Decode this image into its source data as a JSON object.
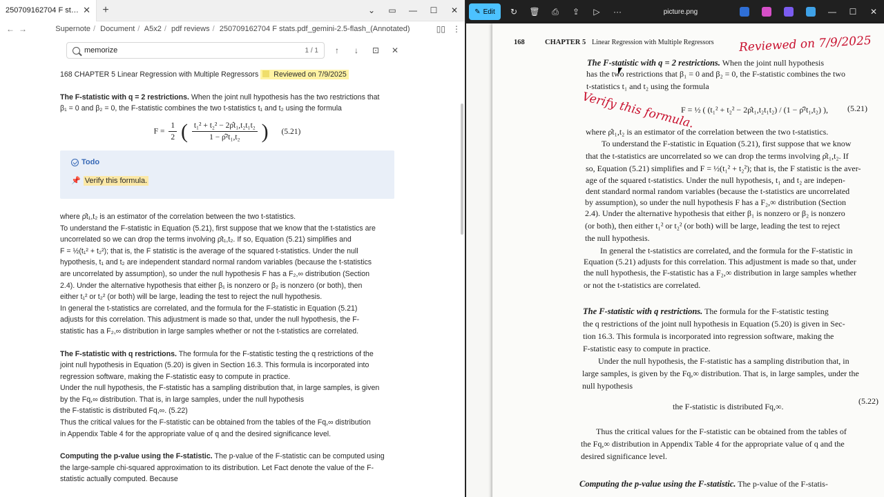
{
  "left_window": {
    "tab_title": "250709162704 F stats.pdf_...",
    "breadcrumbs": [
      "Supernote",
      "Document",
      "A5x2",
      "pdf reviews",
      "250709162704 F stats.pdf_gemini-2.5-flash_(Annotated)"
    ],
    "search": {
      "query": "memorize",
      "count": "1 / 1"
    },
    "doc": {
      "heading": "168 CHAPTER 5 Linear Regression with Multiple Regressors",
      "highlight": "Reviewed on 7/9/2025",
      "p1": [
        "The F-statistic with q = 2 restrictions. When the joint null hypothesis has the two restrictions that",
        "β₁ = 0 and β₂ = 0, the F-statistic combines the two t-statistics t₁ and t₂ using the formula"
      ],
      "formula": {
        "lhs": "F =",
        "half": "1/2",
        "num": "t₁² + t₂² − 2ρ̂t₁,t₂t₁t₂",
        "den": "1 − ρ̂²t₁,t₂",
        "eqno": "(5.21)"
      },
      "todo": {
        "title": "Todo",
        "item": "Verify this formula."
      },
      "p2": [
        "where ρ̂t₁,t₂ is an estimator of the correlation between the two t-statistics.",
        "To understand the F-statistic in Equation (5.21), first suppose that we know that the t-statistics are",
        "uncorrelated so we can drop the terms involving ρ̂t₁,t₂. If so, Equation (5.21) simplifies and",
        "F = ½(t₁² + t₂²); that is, the F statistic is the average of the squared t-statistics. Under the null",
        "hypothesis, t₁ and t₂ are independent standard normal random variables (because the t-statistics",
        "are uncorrelated by assumption), so under the null hypothesis F has a F₂,∞ distribution (Section",
        "2.4). Under the alternative hypothesis that either β₁ is nonzero or β₂ is nonzero (or both), then",
        "either t₁² or t₂² (or both) will be large, leading the test to reject the null hypothesis.",
        "In general the t-statistics are correlated, and the formula for the F-statistic in Equation (5.21)",
        "adjusts for this correlation. This adjustment is made so that, under the null hypothesis, the F-",
        "statistic has a F₂,∞ distribution in large samples whether or not the t-statistics are correlated."
      ],
      "p3": [
        "The F-statistic with q restrictions. The formula for the F-statistic testing the q restrictions of the",
        "joint null hypothesis in Equation (5.20) is given in Section 16.3. This formula is incorporated into",
        "regression software, making the F-statistic easy to compute in practice.",
        "Under the null hypothesis, the F-statistic has a sampling distribution that, in large samples, is given",
        "by the Fq,∞ distribution. That is, in large samples, under the null hypothesis",
        "the F-statistic is distributed Fq,∞. (5.22)",
        "Thus the critical values for the F-statistic can be obtained from the tables of the Fq,∞ distribution",
        "in Appendix Table 4 for the appropriate value of q and the desired significance level."
      ],
      "p4": [
        "Computing the p-value using the F-statistic. The p-value of the F-statistic can be computed using",
        "the large-sample chi-squared approximation to its distribution. Let Fact denote the value of the F-",
        "statistic actually computed. Because"
      ]
    }
  },
  "right_window": {
    "title": "picture.png",
    "edit_label": "Edit",
    "scan": {
      "page_no": "168",
      "chapter": "CHAPTER 5",
      "running_title": "Linear Regression with Multiple Regressors",
      "lines": [
        "The F-statistic with q = 2 restrictions.  When the joint null hypothesis",
        "has the two restrictions that β₁ = 0 and β₂ = 0, the F-statistic combines the two",
        "t-statistics t₁ and t₂ using the formula",
        "F = ½ ( (t₁² + t₂² − 2ρ̂t₁,t₂t₁t₂) / (1 − ρ̂²t₁,t₂) ),",
        "(5.21)",
        "where ρ̂t₁,t₂ is an estimator of the correlation between the two t-statistics.",
        "To understand the F-statistic in Equation (5.21), first suppose that we know",
        "that the t-statistics are uncorrelated so we can drop the terms involving ρ̂t₁,t₂. If",
        "so, Equation (5.21) simplifies and F = ½(t₁² + t₂²); that is, the F statistic is the aver-",
        "age of the squared t-statistics. Under the null hypothesis, t₁ and t₂ are indepen-",
        "dent standard normal random variables (because the t-statistics are uncorrelated",
        "by assumption), so under the null hypothesis F has a F₂,∞ distribution (Section",
        "2.4). Under the alternative hypothesis that either β₁ is nonzero or β₂ is nonzero",
        "(or both), then either t₁² or t₂² (or both) will be large, leading the test to reject",
        "the null hypothesis.",
        "In general the t-statistics are correlated, and the formula for the F-statistic in",
        "Equation (5.21) adjusts for this correlation. This adjustment is made so that, under",
        "the null hypothesis, the F-statistic has a F₂,∞ distribution in large samples whether",
        "or not the t-statistics are correlated.",
        "The F-statistic with q restrictions.  The formula for the F-statistic testing",
        "the q restrictions of the joint null hypothesis in Equation (5.20) is given in Sec-",
        "tion 16.3. This formula is incorporated into regression software, making the",
        "F-statistic easy to compute in practice.",
        "Under the null hypothesis, the F-statistic has a sampling distribution that, in",
        "large samples, is given by the Fq,∞ distribution. That is, in large samples, under the",
        "null hypothesis",
        "the F-statistic is distributed Fq,∞.",
        "(5.22)",
        "Thus the critical values for the F-statistic can be obtained from the tables of",
        "the Fq,∞ distribution in Appendix Table 4 for the appropriate value of q and the",
        "desired significance level.",
        "Computing the p-value using the F-statistic.  The p-value of the F-statis-"
      ],
      "annotation_reviewed": "Reviewed on 7/9/2025",
      "annotation_verify": "Verify this formula."
    }
  }
}
